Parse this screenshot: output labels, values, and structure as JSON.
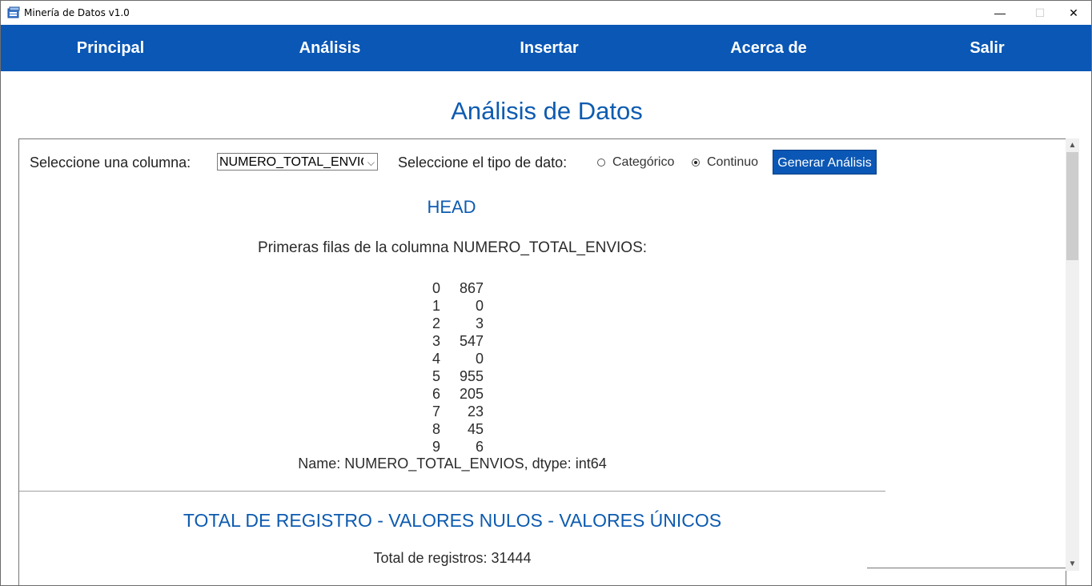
{
  "window": {
    "title": "Minería de Datos v1.0",
    "minimize": "—",
    "maximize": "☐",
    "close": "✕"
  },
  "nav": {
    "items": [
      "Principal",
      "Análisis",
      "Insertar",
      "Acerca de",
      "Salir"
    ]
  },
  "page": {
    "title": "Análisis de Datos"
  },
  "controls": {
    "column_label": "Seleccione una columna:",
    "column_value": "NUMERO_TOTAL_ENVIOS",
    "type_label": "Seleccione el tipo de dato:",
    "type_options": [
      "Categórico",
      "Continuo"
    ],
    "type_selected": "Continuo",
    "generate_button": "Generar Análisis"
  },
  "head_section": {
    "title": "HEAD",
    "intro": "Primeras filas de la columna NUMERO_TOTAL_ENVIOS:",
    "rows": [
      {
        "idx": "0",
        "val": "867"
      },
      {
        "idx": "1",
        "val": "0"
      },
      {
        "idx": "2",
        "val": "3"
      },
      {
        "idx": "3",
        "val": "547"
      },
      {
        "idx": "4",
        "val": "0"
      },
      {
        "idx": "5",
        "val": "955"
      },
      {
        "idx": "6",
        "val": "205"
      },
      {
        "idx": "7",
        "val": "23"
      },
      {
        "idx": "8",
        "val": "45"
      },
      {
        "idx": "9",
        "val": "6"
      }
    ],
    "footer": "Name: NUMERO_TOTAL_ENVIOS, dtype: int64"
  },
  "totals_section": {
    "title": "TOTAL DE REGISTRO - VALORES NULOS - VALORES ÚNICOS",
    "total_records": "Total de registros: 31444"
  },
  "colors": {
    "nav_bg": "#0a57b5",
    "heading": "#0d5bb0"
  }
}
